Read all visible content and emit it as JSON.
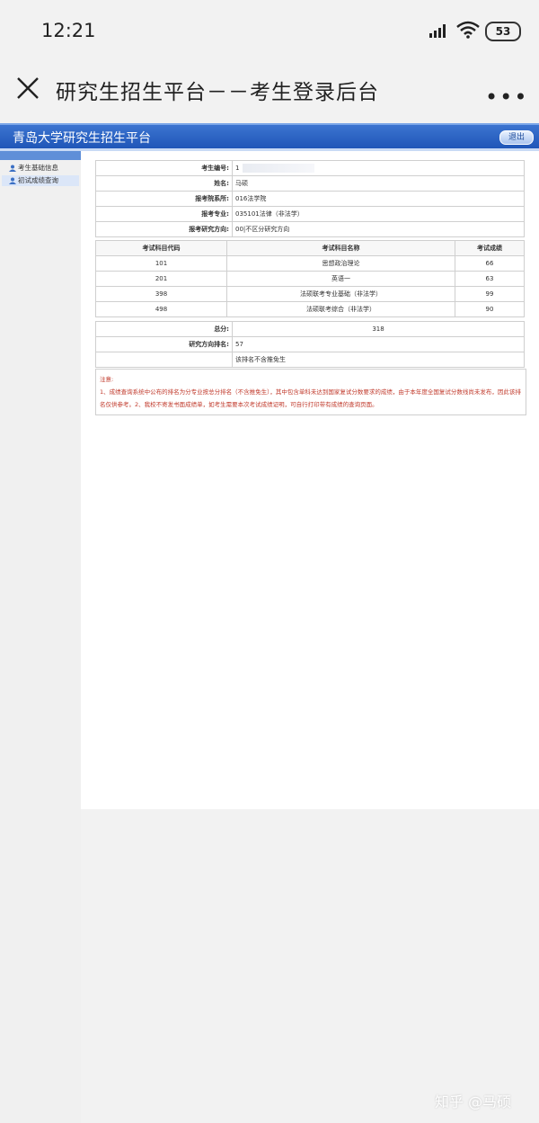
{
  "status_bar": {
    "time": "12:21",
    "battery": "53"
  },
  "title_bar": {
    "title": "研究生招生平台－－考生登录后台",
    "more_label": "•••"
  },
  "site": {
    "title": "青岛大学研究生招生平台",
    "logout_label": "退出"
  },
  "sidebar": {
    "items": [
      {
        "label": "考生基础信息",
        "icon": "user-icon"
      },
      {
        "label": "初试成绩查询",
        "icon": "user-icon"
      }
    ]
  },
  "info": {
    "rows": [
      {
        "label": "考生编号:",
        "value": "1"
      },
      {
        "label": "姓名:",
        "value": "马硕"
      },
      {
        "label": "报考院系所:",
        "value": "016法学院"
      },
      {
        "label": "报考专业:",
        "value": "035101法律（非法学）"
      },
      {
        "label": "报考研究方向:",
        "value": "00|不区分研究方向"
      }
    ]
  },
  "scores": {
    "headers": [
      "考试科目代码",
      "考试科目名称",
      "考试成绩"
    ],
    "rows": [
      {
        "code": "101",
        "name": "思想政治理论",
        "score": "66"
      },
      {
        "code": "201",
        "name": "英语一",
        "score": "63"
      },
      {
        "code": "398",
        "name": "法硕联考专业基础（非法学）",
        "score": "99"
      },
      {
        "code": "498",
        "name": "法硕联考综合（非法学）",
        "score": "90"
      }
    ]
  },
  "summary": {
    "total_label": "总分:",
    "total_value": "318",
    "rank_label": "研究方向排名:",
    "rank_value": "57",
    "rank_note": "该排名不含推免生"
  },
  "notes": {
    "title": "注意:",
    "text": "1、成绩查询系统中公布的排名为分专业按总分排名（不含推免生），其中包含单科未达到国家复试分数要求的成绩，由于本年度全国复试分数线尚未发布，因此该排名仅供参考。2、我校不寄发书面成绩单，如考生需要本次考试成绩证明，可自行打印带有成绩的查询页面。"
  },
  "watermark": "知乎 @马硕"
}
